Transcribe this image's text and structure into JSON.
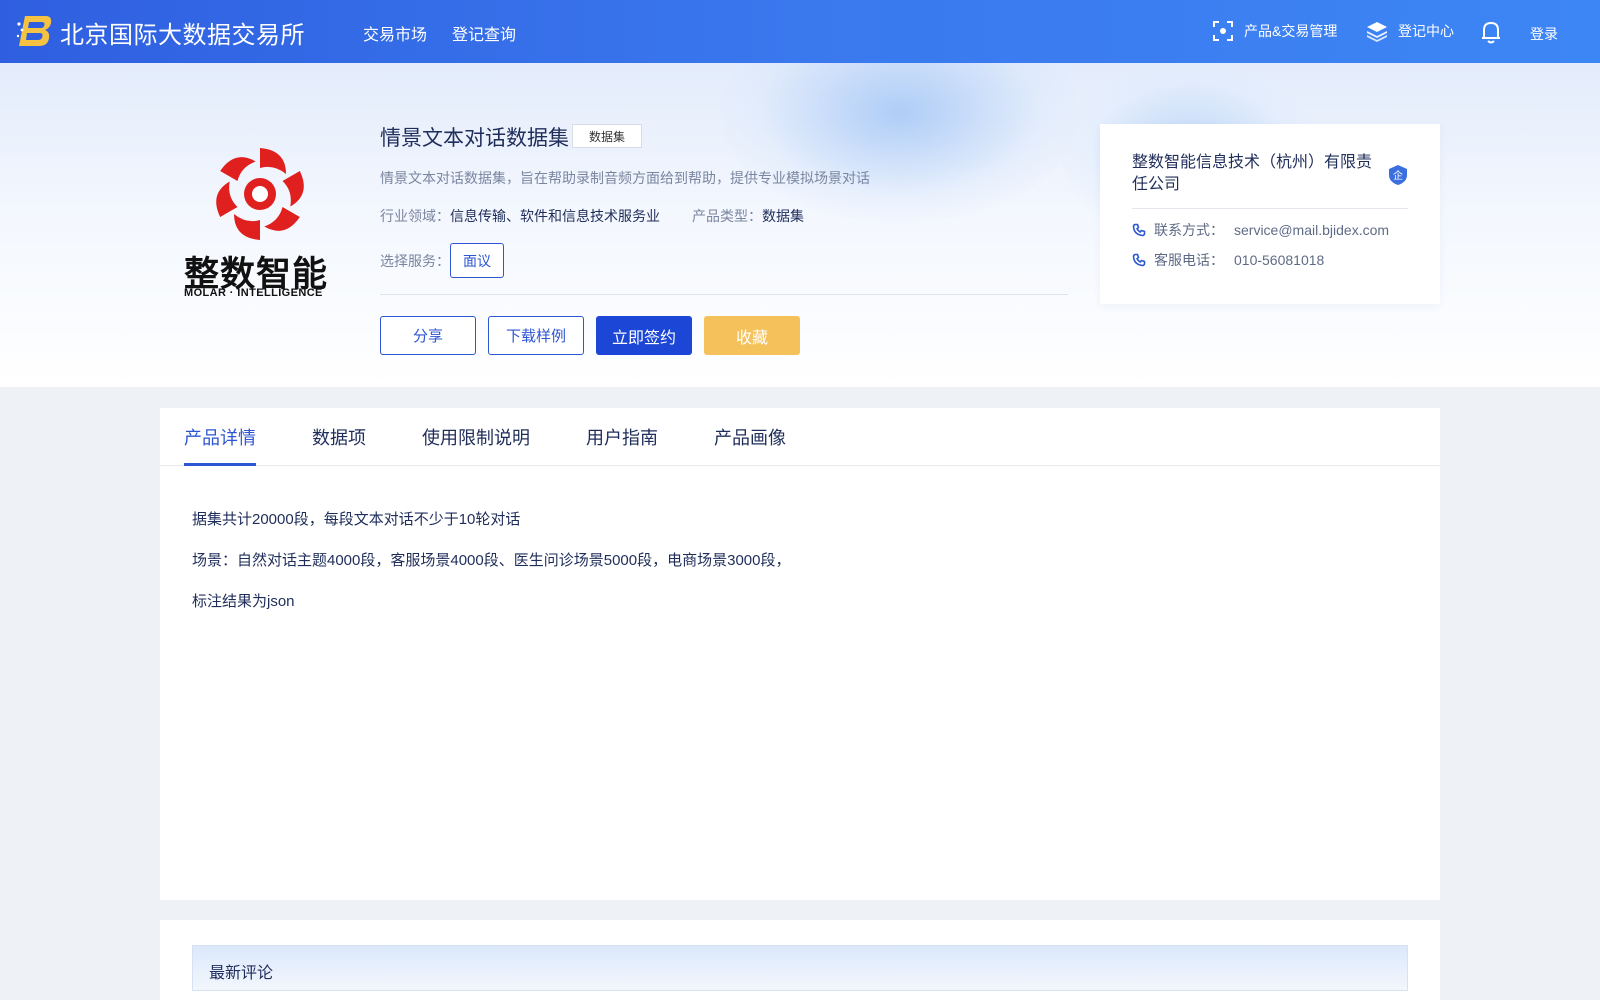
{
  "header": {
    "site_title": "北京国际大数据交易所",
    "nav": {
      "market": "交易市场",
      "query": "登记查询"
    },
    "right": {
      "product_mgmt": "产品&交易管理",
      "register_center": "登记中心",
      "login": "登录"
    }
  },
  "brand": {
    "name_cn": "整数智能",
    "name_en": "MOLAR · INTELLIGENCE"
  },
  "product": {
    "title": "情景文本对话数据集",
    "badge": "数据集",
    "description": "情景文本对话数据集，旨在帮助录制音频方面给到帮助，提供专业模拟场景对话",
    "industry_label": "行业领域：",
    "industry_value": "信息传输、软件和信息技术服务业",
    "type_label": "产品类型：",
    "type_value": "数据集",
    "service_label": "选择服务：",
    "service_option": "面议",
    "actions": {
      "share": "分享",
      "sample": "下载样例",
      "sign": "立即签约",
      "favorite": "收藏"
    }
  },
  "company": {
    "name": "整数智能信息技术（杭州）有限责任公司",
    "badge": "企",
    "contact_label": "联系方式：",
    "contact_value": "service@mail.bjidex.com",
    "phone_label": "客服电话：",
    "phone_value": "010-56081018"
  },
  "tabs": [
    "产品详情",
    "数据项",
    "使用限制说明",
    "用户指南",
    "产品画像"
  ],
  "details": [
    "据集共计20000段，每段文本对话不少于10轮对话",
    "场景：自然对话主题4000段，客服场景4000段、医生问诊场景5000段，电商场景3000段，",
    "标注结果为json"
  ],
  "comments": {
    "title": "最新评论"
  },
  "colors": {
    "primary": "#2d56d2",
    "sign_button": "#1c46d6",
    "favorite_button": "#f5c15a",
    "brand_red": "#e0201f"
  }
}
